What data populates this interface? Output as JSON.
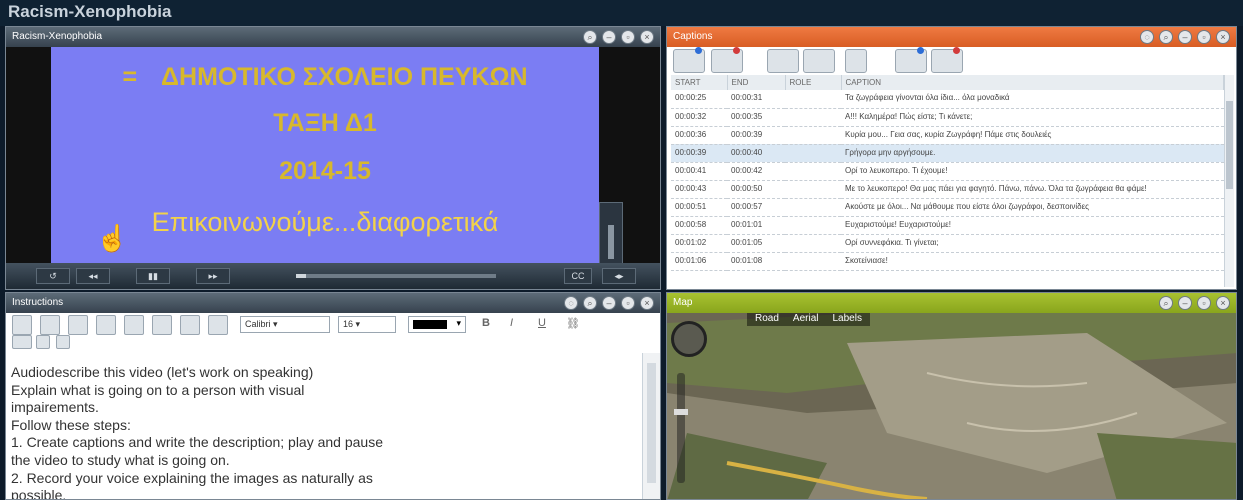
{
  "app": {
    "title": "Racism-Xenophobia"
  },
  "video_panel": {
    "title": "Racism-Xenophobia",
    "slide_lines": [
      "ΔΗΜΟΤΙΚΟ ΣΧΟΛΕΙΟ ΠΕΥΚΩΝ",
      "ΤΑΞΗ Δ1",
      "2014-15",
      "Επικοινωνούμε...διαφορετικά"
    ],
    "bullet": "=",
    "controls": [
      "↺",
      "◂◂",
      "▮▮",
      "▸▸"
    ],
    "cc_label": "CC",
    "playback_progress": 0.05,
    "volume_level": 0.8
  },
  "captions_panel": {
    "title": "Captions",
    "columns": [
      "START",
      "END",
      "ROLE",
      "CAPTION"
    ],
    "rows": [
      {
        "start": "00:00:25",
        "end": "00:00:31",
        "role": "",
        "caption": "Τα ζωγράφεια γίνονται όλα ίδια... όλα μοναδικά"
      },
      {
        "start": "00:00:32",
        "end": "00:00:35",
        "role": "",
        "caption": "Α!!! Καλημέρα! Πώς είστε; Τι κάνετε;"
      },
      {
        "start": "00:00:36",
        "end": "00:00:39",
        "role": "",
        "caption": "Κυρία μου... Γεια σας, κυρία Ζωγράφη! Πάμε στις δουλειές"
      },
      {
        "start": "00:00:39",
        "end": "00:00:40",
        "role": "",
        "caption": "Γρήγορα μην αργήσουμε."
      },
      {
        "start": "00:00:41",
        "end": "00:00:42",
        "role": "",
        "caption": "Ορί το λευκοπερο. Τι έχουμε!"
      },
      {
        "start": "00:00:43",
        "end": "00:00:50",
        "role": "",
        "caption": "Με το λευκοπερο! Θα μας πάει για φαγητό. Πάνω, πάνω. Όλα τα ζωγράφεια θα φάμε!"
      },
      {
        "start": "00:00:51",
        "end": "00:00:57",
        "role": "",
        "caption": "Ακούστε με όλοι... Να μάθουμε που είστε όλοι ζωγράφοι, δεσποινίδες"
      },
      {
        "start": "00:00:58",
        "end": "00:01:01",
        "role": "",
        "caption": "Ευχαριστούμε! Ευχαριστούμε!"
      },
      {
        "start": "00:01:02",
        "end": "00:01:05",
        "role": "",
        "caption": "Ορί συννεφάκια. Τι γίνεται;"
      },
      {
        "start": "00:01:06",
        "end": "00:01:08",
        "role": "",
        "caption": "Σκοτείνιασε!"
      }
    ],
    "selected_row": 3
  },
  "instructions_panel": {
    "title": "Instructions",
    "font_name": "Calibri",
    "font_size": "16",
    "format_labels": {
      "bold": "B",
      "italic": "I",
      "underline": "U"
    },
    "lines": [
      "Audiodescribe this video (let's work on speaking)",
      "Explain what is going on to a person with visual",
      "impairements.",
      "Follow these steps:",
      "1. Create captions and write the description; play and pause",
      "the video to study what is going on.",
      "2. Record your voice explaining the images as naturally as",
      "possible."
    ]
  },
  "map_panel": {
    "title": "Map",
    "nav": [
      "Road",
      "Aerial",
      "Labels"
    ]
  },
  "colors": {
    "video_header": "#36424e",
    "captions_header": "#d85d24",
    "map_header": "#89a51d",
    "slide_bg": "#7b7df3",
    "slide_text": "#d7b82c"
  }
}
